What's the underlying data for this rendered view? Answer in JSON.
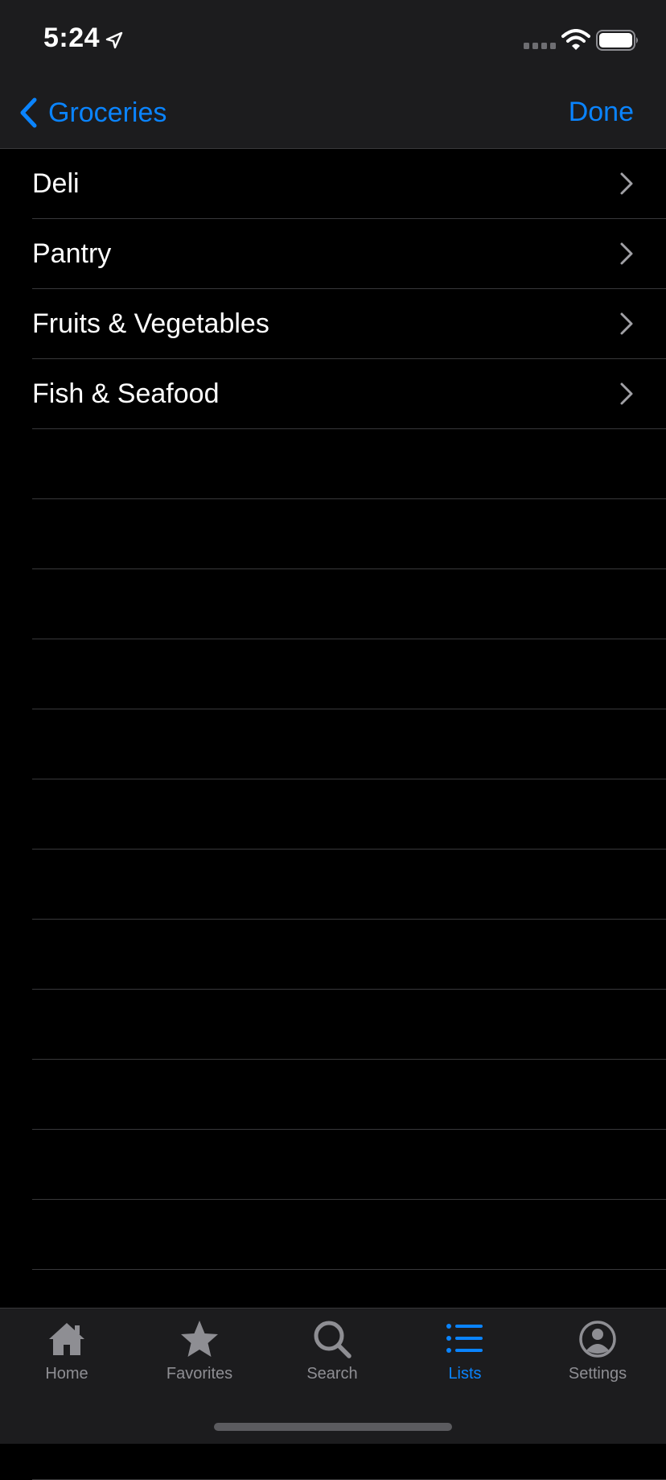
{
  "status_bar": {
    "time": "5:24"
  },
  "nav_bar": {
    "back_label": "Groceries",
    "done_label": "Done"
  },
  "list": {
    "items": [
      {
        "label": "Deli"
      },
      {
        "label": "Pantry"
      },
      {
        "label": "Fruits & Vegetables"
      },
      {
        "label": "Fish & Seafood"
      }
    ]
  },
  "tab_bar": {
    "tabs": [
      {
        "label": "Home",
        "icon": "house-icon"
      },
      {
        "label": "Favorites",
        "icon": "star-icon"
      },
      {
        "label": "Search",
        "icon": "magnifier-icon"
      },
      {
        "label": "Lists",
        "icon": "list-icon",
        "active": true
      },
      {
        "label": "Settings",
        "icon": "person-circle-icon"
      }
    ]
  },
  "colors": {
    "accent": "#0a84ff",
    "bar_background": "#1c1c1e",
    "background": "#000000",
    "separator": "#38383a",
    "inactive_tab": "#8e8e93"
  }
}
